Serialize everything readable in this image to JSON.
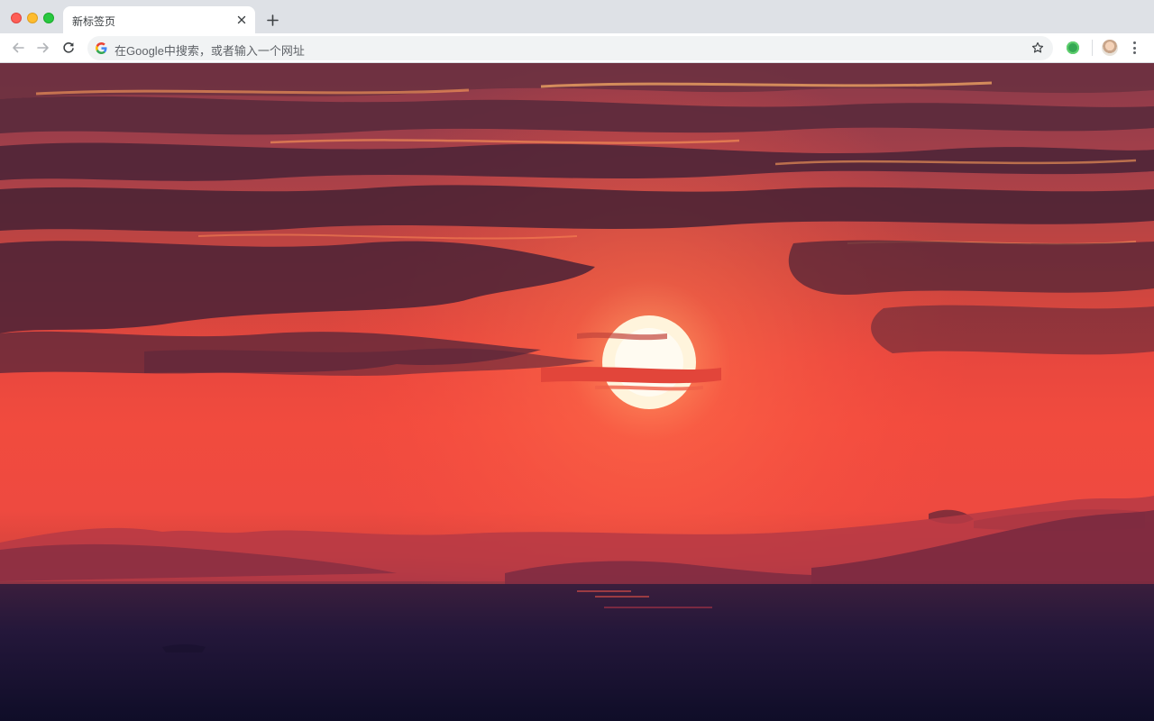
{
  "browser": {
    "tab": {
      "title": "新标签页"
    },
    "new_tab_glyph": "+",
    "close_glyph": "×",
    "omnibox": {
      "placeholder": "在Google中搜索，或者输入一个网址"
    },
    "icons": [
      "back-arrow-icon",
      "forward-arrow-icon",
      "reload-icon",
      "google-g-icon",
      "bookmark-star-icon",
      "extension-icon",
      "profile-avatar",
      "more-menu-icon"
    ],
    "colors": {
      "tabstrip": "#dee1e6",
      "toolbar": "#ffffff",
      "omnibox": "#f1f3f4"
    }
  },
  "wallpaper": {
    "subject": "sunset-over-sea",
    "colors": {
      "sky": "#f14b3e",
      "sun": "#fff6e0",
      "sea": "#120f2a"
    }
  }
}
